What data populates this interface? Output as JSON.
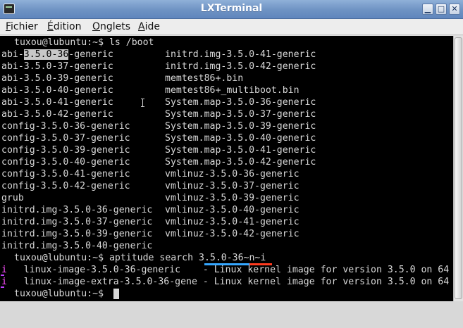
{
  "window": {
    "title": "LXTerminal",
    "buttons": {
      "minimize": "▁",
      "maximize": "□",
      "close": "✕"
    }
  },
  "menu": [
    {
      "label_u": "F",
      "label_rest": "ichier"
    },
    {
      "label_u": "É",
      "label_rest": "dition"
    },
    {
      "label_pre": "",
      "label_u": "O",
      "label_rest": "nglets"
    },
    {
      "label_u": "A",
      "label_rest": "ide"
    }
  ],
  "terminal": {
    "prompt1": "tuxou@lubuntu:~$ ls /boot",
    "ls_col1": [
      "abi-3.5.0-36-generic",
      "abi-3.5.0-37-generic",
      "abi-3.5.0-39-generic",
      "abi-3.5.0-40-generic",
      "abi-3.5.0-41-generic",
      "abi-3.5.0-42-generic",
      "config-3.5.0-36-generic",
      "config-3.5.0-37-generic",
      "config-3.5.0-39-generic",
      "config-3.5.0-40-generic",
      "config-3.5.0-41-generic",
      "config-3.5.0-42-generic",
      "grub",
      "initrd.img-3.5.0-36-generic",
      "initrd.img-3.5.0-37-generic",
      "initrd.img-3.5.0-39-generic",
      "initrd.img-3.5.0-40-generic"
    ],
    "ls_col2": [
      "initrd.img-3.5.0-41-generic",
      "initrd.img-3.5.0-42-generic",
      "memtest86+.bin",
      "memtest86+_multiboot.bin",
      "System.map-3.5.0-36-generic",
      "System.map-3.5.0-37-generic",
      "System.map-3.5.0-39-generic",
      "System.map-3.5.0-40-generic",
      "System.map-3.5.0-41-generic",
      "System.map-3.5.0-42-generic",
      "vmlinuz-3.5.0-36-generic",
      "vmlinuz-3.5.0-37-generic",
      "vmlinuz-3.5.0-39-generic",
      "vmlinuz-3.5.0-40-generic",
      "vmlinuz-3.5.0-41-generic",
      "vmlinuz-3.5.0-42-generic"
    ],
    "first_line_prefix": "abi-",
    "first_line_selection": "3.5.0-36",
    "first_line_suffix": "-generic",
    "prompt2_prefix": "tuxou@lubuntu:~$ aptitude search ",
    "prompt2_arg": "3.5.0-36~n~i",
    "result1": {
      "flag": "i",
      "text": "   linux-image-3.5.0-36-generic    - Linux kernel image for version 3.5.0 on 64"
    },
    "result2": {
      "flag": "i",
      "text": "   linux-image-extra-3.5.0-36-gene - Linux kernel image for version 3.5.0 on 64"
    },
    "prompt3": "tuxou@lubuntu:~$ "
  },
  "colors": {
    "terminal_bg": "#000000",
    "terminal_fg": "#d8d8d8",
    "underline_blue": "#35a7ff",
    "underline_red": "#ff3b1f",
    "flag_magenta": "#ff4fff"
  }
}
